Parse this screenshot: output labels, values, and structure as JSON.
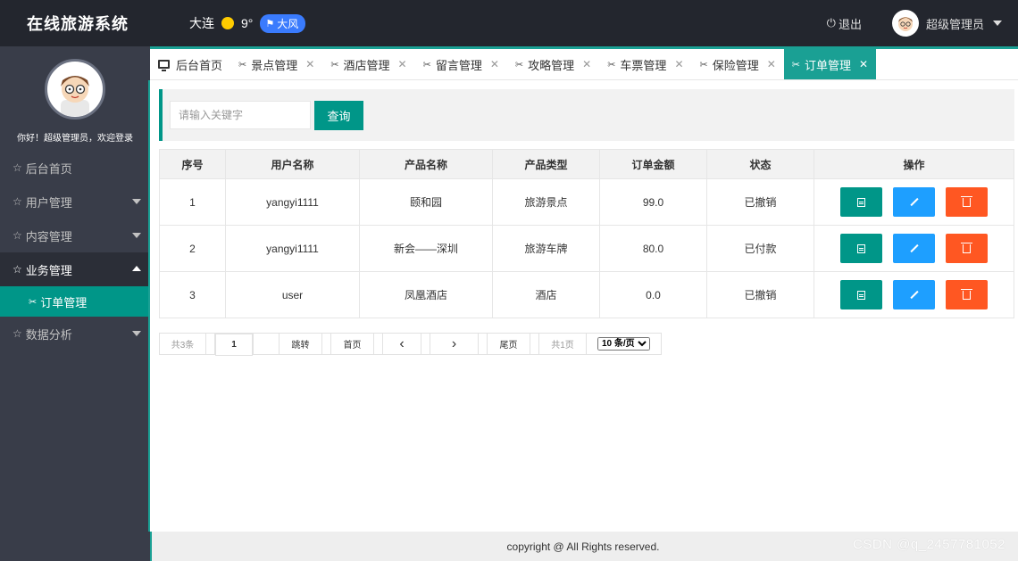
{
  "header": {
    "app_title": "在线旅游系统",
    "weather": {
      "city": "大连",
      "temperature": "9°",
      "condition": "大风"
    },
    "logout_label": "退出",
    "user_name": "超级管理员"
  },
  "sidebar": {
    "welcome": "你好！超级管理员，欢迎登录",
    "items": [
      {
        "label": "后台首页"
      },
      {
        "label": "用户管理"
      },
      {
        "label": "内容管理"
      },
      {
        "label": "业务管理"
      },
      {
        "label": "数据分析"
      }
    ],
    "sub_item": {
      "label": "订单管理"
    }
  },
  "tabs": [
    {
      "label": "后台首页"
    },
    {
      "label": "景点管理"
    },
    {
      "label": "酒店管理"
    },
    {
      "label": "留言管理"
    },
    {
      "label": "攻略管理"
    },
    {
      "label": "车票管理"
    },
    {
      "label": "保险管理"
    },
    {
      "label": "订单管理"
    }
  ],
  "search": {
    "placeholder": "请输入关键字",
    "button_label": "查询"
  },
  "table": {
    "headers": [
      "序号",
      "用户名称",
      "产品名称",
      "产品类型",
      "订单金额",
      "状态",
      "操作"
    ],
    "rows": [
      [
        "1",
        "yangyi1111",
        "颐和园",
        "旅游景点",
        "99.0",
        "已撤销"
      ],
      [
        "2",
        "yangyi1111",
        "新会——深圳",
        "旅游车牌",
        "80.0",
        "已付款"
      ],
      [
        "3",
        "user",
        "凤凰酒店",
        "酒店",
        "0.0",
        "已撤销"
      ]
    ]
  },
  "pager": {
    "total": "共3条",
    "page": "1",
    "jump": "跳转",
    "first": "首页",
    "prev": "‹",
    "next": "›",
    "last": "尾页",
    "pages": "共1页",
    "page_size": "10 条/页"
  },
  "footer": {
    "copyright": "copyright @ All Rights reserved."
  },
  "watermark": "CSDN @q_2457781052",
  "colors": {
    "primary": "#009688",
    "edit": "#1e9fff",
    "delete": "#ff5722",
    "topbar": "#23262e",
    "sidebar": "#393d49"
  }
}
